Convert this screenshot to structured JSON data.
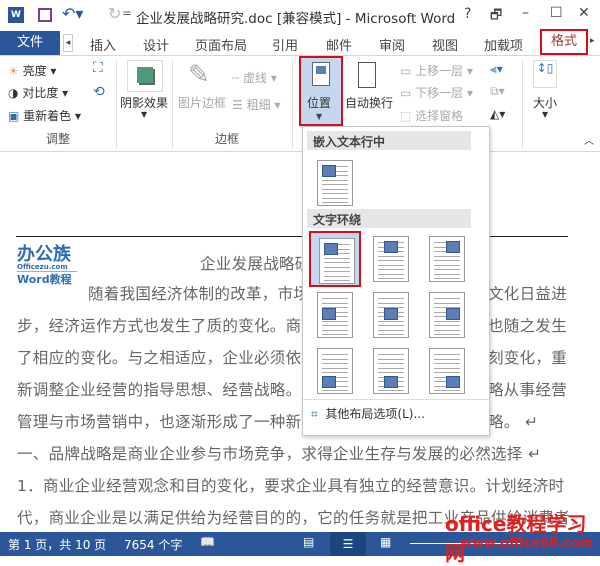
{
  "title_bar": {
    "title": "企业发展战略研究.doc [兼容模式] - Microsoft Word",
    "help": "?",
    "restore": "🗗",
    "minimize": "–",
    "maximize": "☐",
    "close": "✕"
  },
  "tabs": [
    {
      "label": "文件"
    },
    {
      "label": "插入"
    },
    {
      "label": "设计"
    },
    {
      "label": "页面布局"
    },
    {
      "label": "引用"
    },
    {
      "label": "邮件"
    },
    {
      "label": "审阅"
    },
    {
      "label": "视图"
    },
    {
      "label": "加载项"
    },
    {
      "label": "格式"
    }
  ],
  "ribbon": {
    "adjust": {
      "label": "调整",
      "brightness": "亮度",
      "contrast": "对比度",
      "recolor": "重新着色"
    },
    "shadow": {
      "label": "阴影效果"
    },
    "border": {
      "label": "边框",
      "picture_border": "图片边框",
      "dashes": "虚线",
      "weight": "粗细"
    },
    "arrange": {
      "position": "位置",
      "wrap": "自动换行",
      "bring_forward": "上移一层",
      "send_backward": "下移一层",
      "selection_pane": "选择窗格"
    },
    "size": {
      "label": "大小"
    }
  },
  "dropdown": {
    "inline_header": "嵌入文本行中",
    "wrap_header": "文字环绕",
    "more_options": "其他布局选项(L)..."
  },
  "document": {
    "logo": "办公族 Officezu.com Word教程",
    "lines": [
      "企业发展战略研究",
      "随着我国经济体制的改革，市场",
      "文化日益进",
      "步，经济运作方式也发生了质的变化。商业",
      "也随之发生",
      "了相应的变化。与之相适应，企业必须依据",
      "刻变化，重",
      "新调整企业经营的指导思想、经营战略。商",
      "略从事经营",
      "管理与市场营销中，也逐渐形成了一种新",
      "略。 ↵",
      "一、品牌战略是商业企业参与市场竞争，求得企业生存与发展的必然选择 ↵",
      "1．商业企业经营观念和目的变化，要求企业具有独立的经营意识。计划经济时",
      "代，商业企业是以满足供给为经营目的的，它的任务就是把工业产品供给消费者，"
    ]
  },
  "watermark": {
    "main": "office教程学习网",
    "url": "www.office68.com"
  },
  "status": {
    "page": "第 1 页，共 10 页",
    "words": "7654 个字"
  },
  "colors": {
    "accent": "#2b579a",
    "highlight": "#d70d19"
  }
}
